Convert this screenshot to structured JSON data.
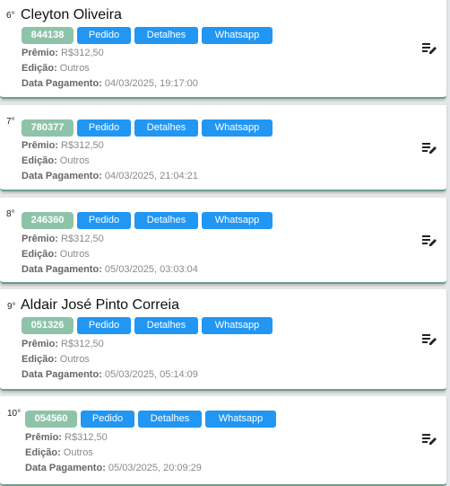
{
  "entries": [
    {
      "rank": "6°",
      "name": "Cleyton Oliveira",
      "code": "844138",
      "pedido": "Pedido",
      "detalhes": "Detalhes",
      "whatsapp": "Whatsapp",
      "premio_label": "Prêmio:",
      "premio": "R$312,50",
      "edicao_label": "Edição:",
      "edicao": "Outros",
      "data_label": "Data Pagamento:",
      "data": "04/03/2025, 19:17:00"
    },
    {
      "rank": "7°",
      "name": "",
      "code": "780377",
      "pedido": "Pedido",
      "detalhes": "Detalhes",
      "whatsapp": "Whatsapp",
      "premio_label": "Prêmio:",
      "premio": "R$312,50",
      "edicao_label": "Edição:",
      "edicao": "Outros",
      "data_label": "Data Pagamento:",
      "data": "04/03/2025, 21:04:21"
    },
    {
      "rank": "8°",
      "name": "",
      "code": "246360",
      "pedido": "Pedido",
      "detalhes": "Detalhes",
      "whatsapp": "Whatsapp",
      "premio_label": "Prêmio:",
      "premio": "R$312,50",
      "edicao_label": "Edição:",
      "edicao": "Outros",
      "data_label": "Data Pagamento:",
      "data": "05/03/2025, 03:03:04"
    },
    {
      "rank": "9°",
      "name": "Aldair José Pinto Correia",
      "code": "051326",
      "pedido": "Pedido",
      "detalhes": "Detalhes",
      "whatsapp": "Whatsapp",
      "premio_label": "Prêmio:",
      "premio": "R$312,50",
      "edicao_label": "Edição:",
      "edicao": "Outros",
      "data_label": "Data Pagamento:",
      "data": "05/03/2025, 05:14:09"
    },
    {
      "rank": "10°",
      "name": "",
      "code": "054560",
      "pedido": "Pedido",
      "detalhes": "Detalhes",
      "whatsapp": "Whatsapp",
      "premio_label": "Prêmio:",
      "premio": "R$312,50",
      "edicao_label": "Edição:",
      "edicao": "Outros",
      "data_label": "Data Pagamento:",
      "data": "05/03/2025, 20:09:29"
    }
  ],
  "icons": {
    "edit": "edit-list-icon"
  },
  "colors": {
    "code_badge": "#8fc3a9",
    "button": "#2196f3",
    "card_border": "#6c9e86"
  }
}
